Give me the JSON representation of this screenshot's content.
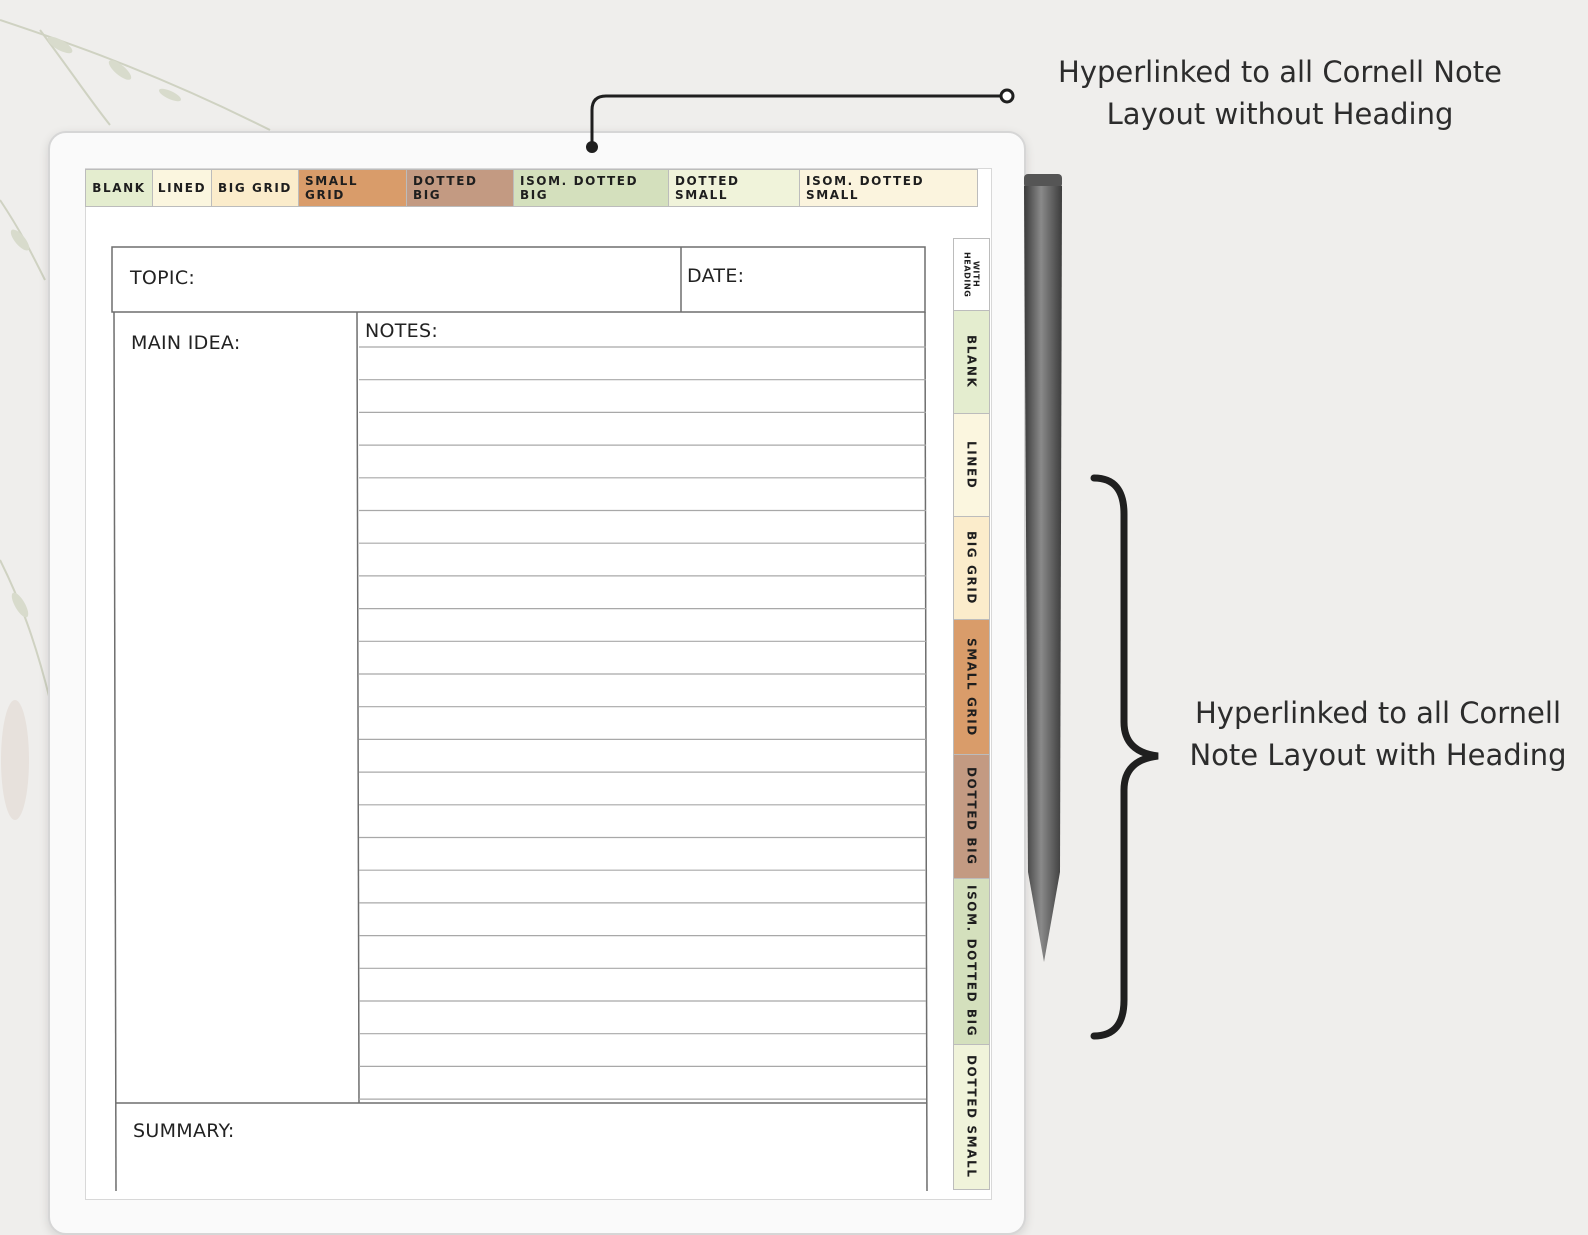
{
  "top_tabs": [
    {
      "label": "BLANK",
      "color": "#e4edcf"
    },
    {
      "label": "LINED",
      "color": "#fbf6df"
    },
    {
      "label": "BIG GRID",
      "color": "#fbeccb"
    },
    {
      "label": "SMALL GRID",
      "color": "#d99c6a"
    },
    {
      "label": "DOTTED BIG",
      "color": "#c39a82"
    },
    {
      "label": "ISOM. DOTTED BIG",
      "color": "#d4e0bd"
    },
    {
      "label": "DOTTED SMALL",
      "color": "#f0f3da"
    },
    {
      "label": "ISOM. DOTTED SMALL",
      "color": "#fbf4de"
    }
  ],
  "side_tabs": [
    {
      "label": "WITH HEADING",
      "color": "#ffffff"
    },
    {
      "label": "BLANK",
      "color": "#e4edcf"
    },
    {
      "label": "LINED",
      "color": "#fbf6df"
    },
    {
      "label": "BIG GRID",
      "color": "#fbeccb"
    },
    {
      "label": "SMALL GRID",
      "color": "#d99c6a"
    },
    {
      "label": "DOTTED BIG",
      "color": "#c39a82"
    },
    {
      "label": "ISOM. DOTTED BIG",
      "color": "#d4e0bd"
    },
    {
      "label": "DOTTED SMALL",
      "color": "#f0f3da"
    }
  ],
  "form": {
    "topic_label": "TOPIC:",
    "date_label": "DATE:",
    "main_idea_label": "MAIN IDEA:",
    "notes_label": "NOTES:",
    "summary_label": "SUMMARY:"
  },
  "callouts": {
    "top_line1": "Hyperlinked to all Cornell Note",
    "top_line2": "Layout without Heading",
    "side_line1": "Hyperlinked to all Cornell",
    "side_line2": "Note Layout with Heading"
  }
}
